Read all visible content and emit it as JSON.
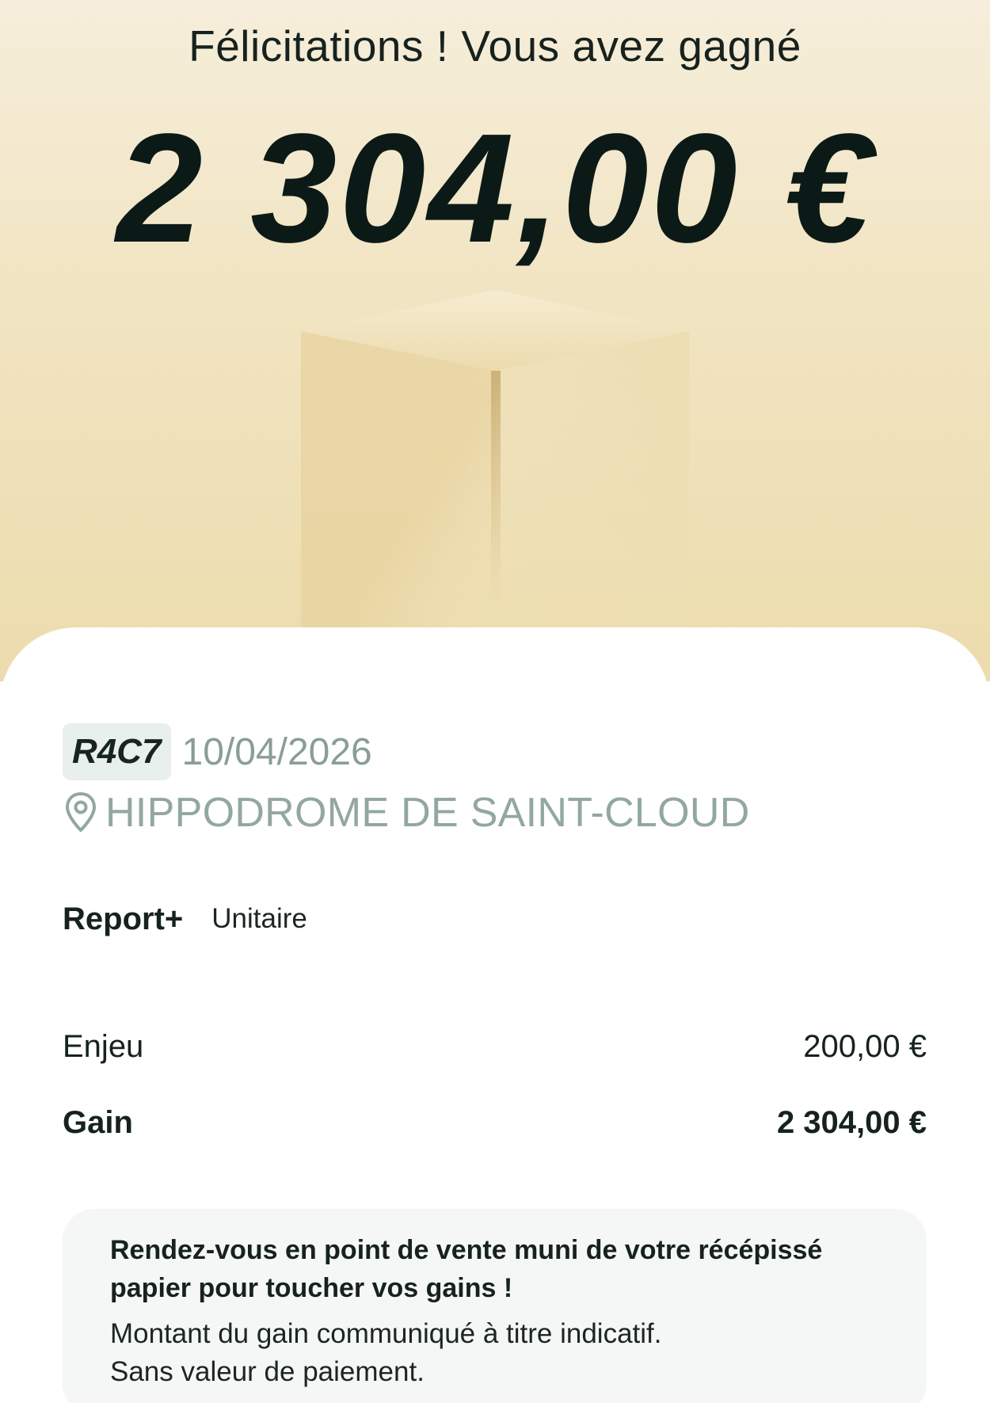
{
  "hero": {
    "title": "Félicitations ! Vous avez gagné",
    "amount": "2 304,00 €"
  },
  "race": {
    "code": "R4C7",
    "date": "10/04/2026",
    "venue": "HIPPODROME DE SAINT-CLOUD"
  },
  "bet": {
    "type": "Report+",
    "formula": "Unitaire"
  },
  "summary": {
    "stake_label": "Enjeu",
    "stake_value": "200,00 €",
    "gain_label": "Gain",
    "gain_value": "2 304,00 €"
  },
  "notice": {
    "title_line1": "Rendez-vous en point de vente muni de votre récépissé",
    "title_line2": "papier pour toucher vos gains !",
    "text_line1": "Montant du gain communiqué à titre indicatif.",
    "text_line2": "Sans valeur de paiement."
  },
  "icons": {
    "venue": "location-pin-icon"
  },
  "colors": {
    "hero_background": "#f1e4c1",
    "amount_text": "#0c1a17",
    "muted_text": "#93a7a2",
    "badge_background": "#e9efed",
    "notice_background": "#f5f6f6"
  }
}
